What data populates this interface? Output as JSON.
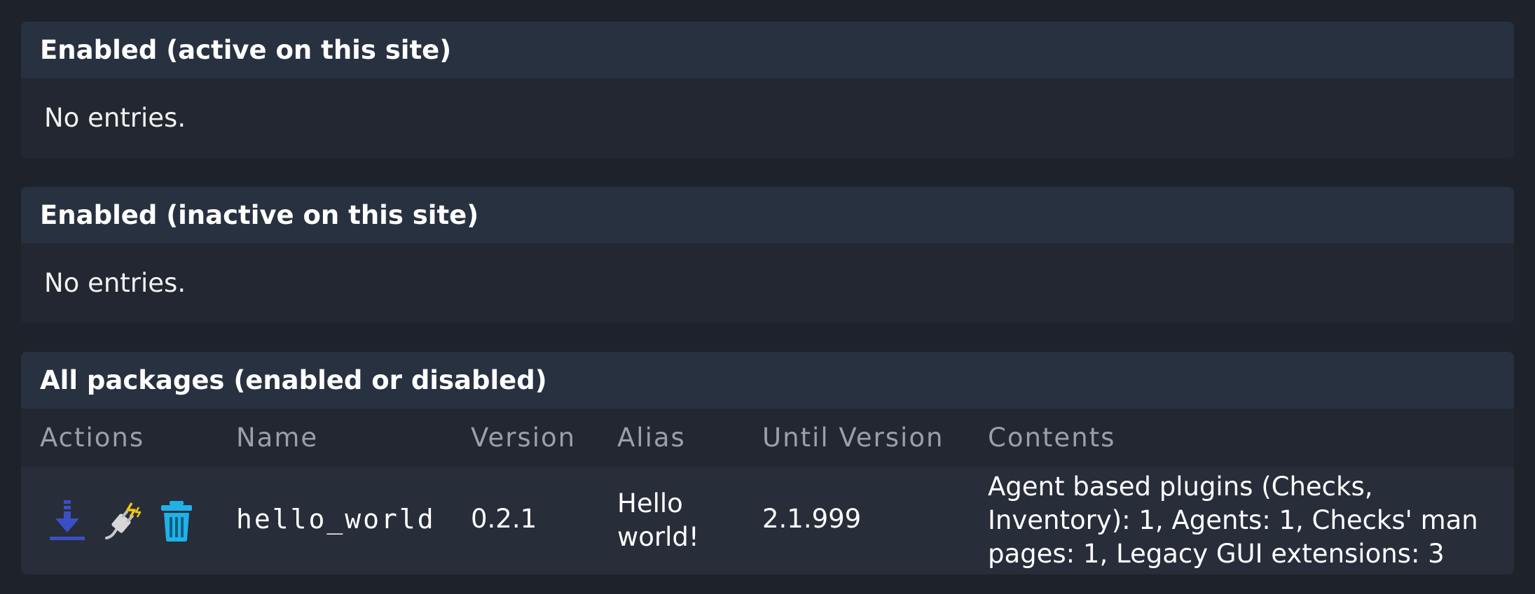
{
  "panels": {
    "active": {
      "title": "Enabled (active on this site)",
      "empty_text": "No entries."
    },
    "inactive": {
      "title": "Enabled (inactive on this site)",
      "empty_text": "No entries."
    },
    "all": {
      "title": "All packages (enabled or disabled)",
      "columns": [
        "Actions",
        "Name",
        "Version",
        "Alias",
        "Until Version",
        "Contents"
      ],
      "rows": [
        {
          "actions": [
            "download-icon",
            "plug-icon",
            "trash-icon"
          ],
          "name": "hello_world",
          "version": "0.2.1",
          "alias": "Hello world!",
          "until_version": "2.1.999",
          "contents": "Agent based plugins (Checks, Inventory): 1, Agents: 1, Checks' man pages: 1, Legacy GUI extensions: 3"
        }
      ]
    }
  },
  "colors": {
    "background": "#1e222b",
    "panel_header": "#283140",
    "panel_body": "#222731",
    "accent_blue": "#3b4fc4",
    "accent_cyan": "#1fb2e8",
    "accent_yellow": "#f5c518"
  }
}
